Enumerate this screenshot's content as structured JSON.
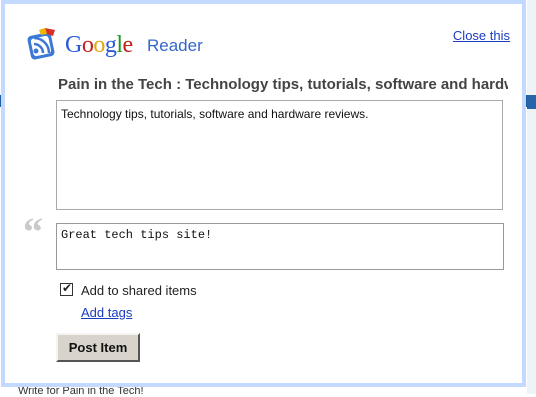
{
  "header": {
    "logo_letters": [
      "G",
      "o",
      "o",
      "g",
      "l",
      "e"
    ],
    "logo_colors": [
      "#2a5ad7",
      "#c2201a",
      "#e3a60f",
      "#2a5ad7",
      "#1b9a2b",
      "#c2201a"
    ],
    "product": "Reader",
    "close_link": "Close this"
  },
  "item": {
    "title": "Pain in the Tech : Technology tips, tutorials, software and hardware reviews.",
    "snippet": "Technology tips, tutorials, software and hardware reviews."
  },
  "note": {
    "value": "Great tech tips site!"
  },
  "share": {
    "checked": true,
    "label": "Add to shared items"
  },
  "tags_link": "Add tags",
  "post_button": "Post Item",
  "background": {
    "fragment_text": "Write for Pain in the Tech!"
  }
}
